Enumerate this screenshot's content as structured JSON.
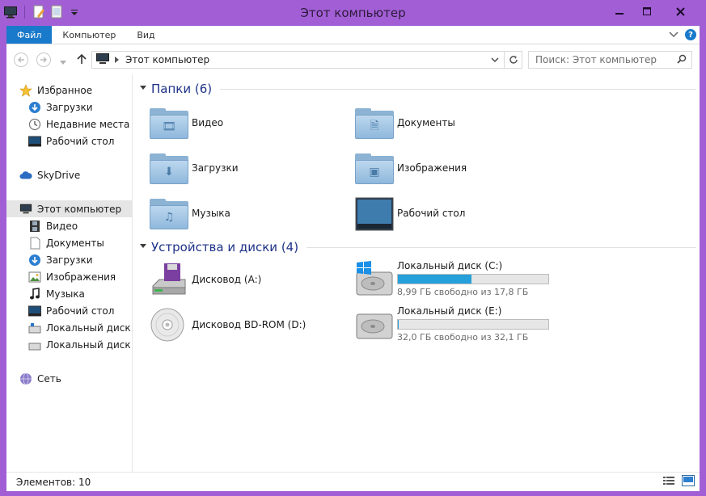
{
  "window": {
    "title": "Этот компьютер"
  },
  "ribbon": {
    "tabs": [
      "Файл",
      "Компьютер",
      "Вид"
    ]
  },
  "address": {
    "path": "Этот компьютер"
  },
  "search": {
    "placeholder": "Поиск: Этот компьютер"
  },
  "nav": {
    "favorites": {
      "label": "Избранное",
      "items": [
        "Загрузки",
        "Недавние места",
        "Рабочий стол"
      ]
    },
    "skydrive": "SkyDrive",
    "computer": {
      "label": "Этот компьютер",
      "items": [
        "Видео",
        "Документы",
        "Загрузки",
        "Изображения",
        "Музыка",
        "Рабочий стол",
        "Локальный диск (C",
        "Локальный диск (E:"
      ]
    },
    "network": "Сеть"
  },
  "folders": {
    "header": "Папки (6)",
    "items": [
      {
        "name": "Видео",
        "icon": "video-folder-icon",
        "glyph": "🎞"
      },
      {
        "name": "Документы",
        "icon": "documents-folder-icon",
        "glyph": "🗎"
      },
      {
        "name": "Загрузки",
        "icon": "downloads-folder-icon",
        "glyph": "⬇"
      },
      {
        "name": "Изображения",
        "icon": "pictures-folder-icon",
        "glyph": "▣"
      },
      {
        "name": "Музыка",
        "icon": "music-folder-icon",
        "glyph": "♫"
      },
      {
        "name": "Рабочий стол",
        "icon": "desktop-folder-icon",
        "glyph": ""
      }
    ]
  },
  "devices": {
    "header": "Устройства и диски (4)",
    "items": [
      {
        "name": "Дисковод (A:)",
        "icon": "floppy-drive-icon"
      },
      {
        "name": "Локальный диск (C:)",
        "icon": "windows-drive-icon",
        "free": "8,99 ГБ свободно из 17,8 ГБ",
        "used_fraction": 0.49
      },
      {
        "name": "Дисковод BD-ROM (D:)",
        "icon": "bd-rom-drive-icon"
      },
      {
        "name": "Локальный диск (E:)",
        "icon": "local-drive-icon",
        "free": "32,0 ГБ свободно из 32,1 ГБ",
        "used_fraction": 0.003
      }
    ]
  },
  "status": {
    "count": "Элементов: 10"
  },
  "colors": {
    "accent": "#1979ca",
    "window_frame": "#a25fd5",
    "header_text": "#1e3287",
    "bar_fill": "#26a0da"
  }
}
